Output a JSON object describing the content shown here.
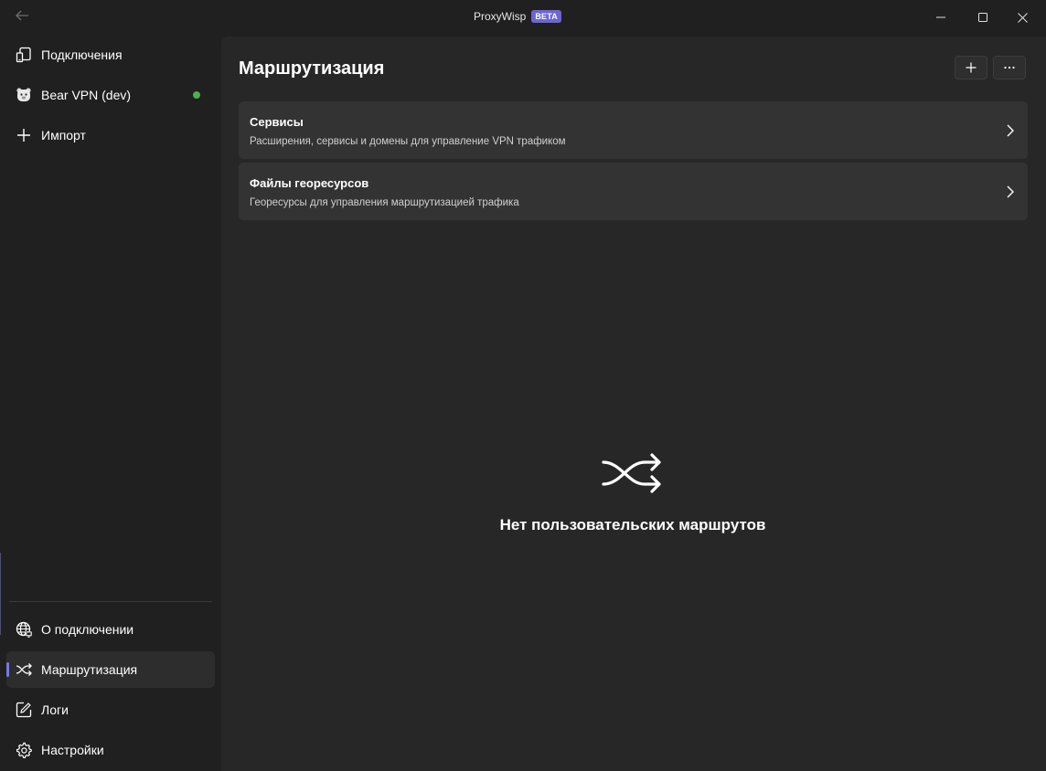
{
  "window": {
    "title": "ProxyWisp",
    "badge": "BETA",
    "icons": {
      "back": "back-arrow-icon",
      "minimize": "minimize-icon",
      "maximize": "maximize-icon",
      "close": "close-icon"
    }
  },
  "sidebar": {
    "top_items": [
      {
        "label": "Подключения",
        "icon": "devices-icon"
      },
      {
        "label": "Bear VPN (dev)",
        "icon": "bear-avatar-icon",
        "status": "connected"
      },
      {
        "label": "Импорт",
        "icon": "plus-icon"
      }
    ],
    "bottom_items": [
      {
        "label": "О подключении",
        "icon": "globe-icon"
      },
      {
        "label": "Маршрутизация",
        "icon": "shuffle-icon",
        "active": true
      },
      {
        "label": "Логи",
        "icon": "edit-log-icon"
      },
      {
        "label": "Настройки",
        "icon": "gear-icon"
      }
    ]
  },
  "main": {
    "title": "Маршрутизация",
    "toolbar": {
      "add_icon": "plus-icon",
      "more_icon": "more-icon"
    },
    "cards": [
      {
        "title": "Сервисы",
        "description": "Расширения, сервисы и домены для управление VPN трафиком"
      },
      {
        "title": "Файлы георесурсов",
        "description": "Георесурсы для управления маршрутизацией трафика"
      }
    ],
    "empty_state": {
      "icon": "shuffle-icon",
      "text": "Нет пользовательских маршрутов"
    }
  },
  "colors": {
    "accent": "#7b74f0",
    "badge": "#6b66d6",
    "status_connected": "#4caf50",
    "background": "#202020",
    "content": "#272727",
    "card": "#333333"
  }
}
